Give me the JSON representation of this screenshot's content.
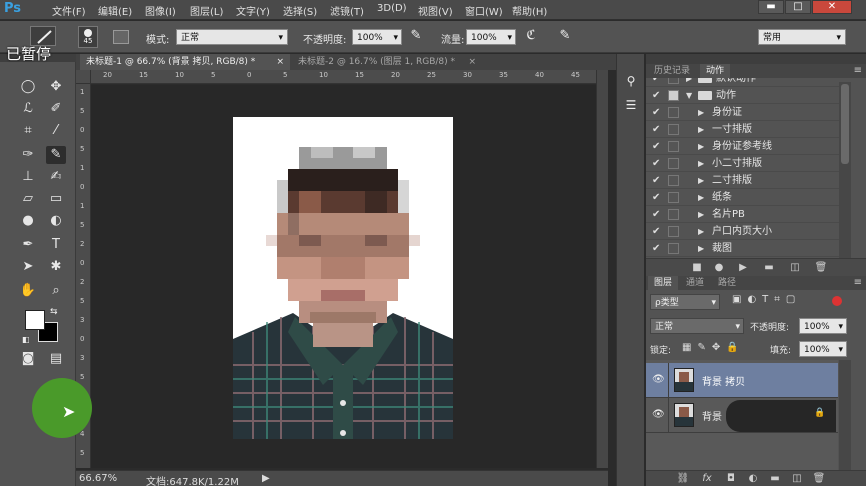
{
  "app": {
    "logo": "Ps"
  },
  "menu": [
    "文件(F)",
    "编辑(E)",
    "图像(I)",
    "图层(L)",
    "文字(Y)",
    "选择(S)",
    "滤镜(T)",
    "3D(D)",
    "视图(V)",
    "窗口(W)",
    "帮助(H)"
  ],
  "window_controls": {
    "minimize": "▬",
    "maximize": "□",
    "close": "✕"
  },
  "options": {
    "brush_size": "45",
    "mode_label": "模式:",
    "mode_value": "正常",
    "opacity_label": "不透明度:",
    "opacity_value": "100%",
    "flow_label": "流量:",
    "flow_value": "100%",
    "workspace": "常用"
  },
  "overlay": {
    "paused": "已暂停"
  },
  "tabs": [
    {
      "label": "未标题-1 @ 66.7% (背景 拷贝, RGB/8) *",
      "close": "×"
    },
    {
      "label": "未标题-2 @ 16.7% (图层 1, RGB/8) *",
      "close": "×"
    }
  ],
  "rulers": {
    "h": [
      "20",
      "15",
      "10",
      "5",
      "0",
      "5",
      "10",
      "15",
      "20",
      "25",
      "30",
      "35",
      "40",
      "45"
    ],
    "v": [
      "1",
      "5",
      "0",
      "5",
      "1",
      "0",
      "1",
      "5",
      "2",
      "0",
      "2",
      "5",
      "3",
      "0",
      "3",
      "5",
      "4",
      "0",
      "4",
      "5"
    ]
  },
  "status": {
    "zoom": "66.67%",
    "doc": "文档:647.8K/1.22M"
  },
  "actions_panel": {
    "tabs": [
      "历史记录",
      "动作"
    ],
    "rows": [
      {
        "label": "默认动作",
        "folder": true,
        "indent": 0,
        "expanded": false
      },
      {
        "label": "动作",
        "folder": true,
        "indent": 0,
        "expanded": true
      },
      {
        "label": "身份证",
        "folder": false,
        "indent": 1
      },
      {
        "label": "一寸排版",
        "folder": false,
        "indent": 1
      },
      {
        "label": "身份证参考线",
        "folder": false,
        "indent": 1
      },
      {
        "label": "小二寸排版",
        "folder": false,
        "indent": 1
      },
      {
        "label": "二寸排版",
        "folder": false,
        "indent": 1
      },
      {
        "label": "纸条",
        "folder": false,
        "indent": 1
      },
      {
        "label": "名片PB",
        "folder": false,
        "indent": 1
      },
      {
        "label": "户口内页大小",
        "folder": false,
        "indent": 1
      },
      {
        "label": "裁图",
        "folder": false,
        "indent": 1
      }
    ],
    "footer_icons": [
      "stop-icon",
      "record-icon",
      "play-icon",
      "new-set-icon",
      "new-action-icon",
      "delete-icon"
    ]
  },
  "layers_panel": {
    "tabs": [
      "图层",
      "通道",
      "路径"
    ],
    "kind_label": "ρ类型",
    "blend_mode": "正常",
    "opacity_label": "不透明度:",
    "opacity_value": "100%",
    "lock_label": "锁定:",
    "fill_label": "填充:",
    "fill_value": "100%",
    "layers": [
      {
        "name": "背景 拷贝",
        "selected": true,
        "locked": false
      },
      {
        "name": "背景",
        "selected": false,
        "locked": true
      }
    ],
    "footer_icons": [
      "link-icon",
      "fx-icon",
      "mask-icon",
      "adjustment-icon",
      "group-icon",
      "new-layer-icon",
      "trash-icon"
    ]
  },
  "colors": {
    "accent_selected_layer": "#6e7fa0",
    "green_cursor": "#4a9a2a",
    "logo_blue": "#3aa0e0"
  }
}
